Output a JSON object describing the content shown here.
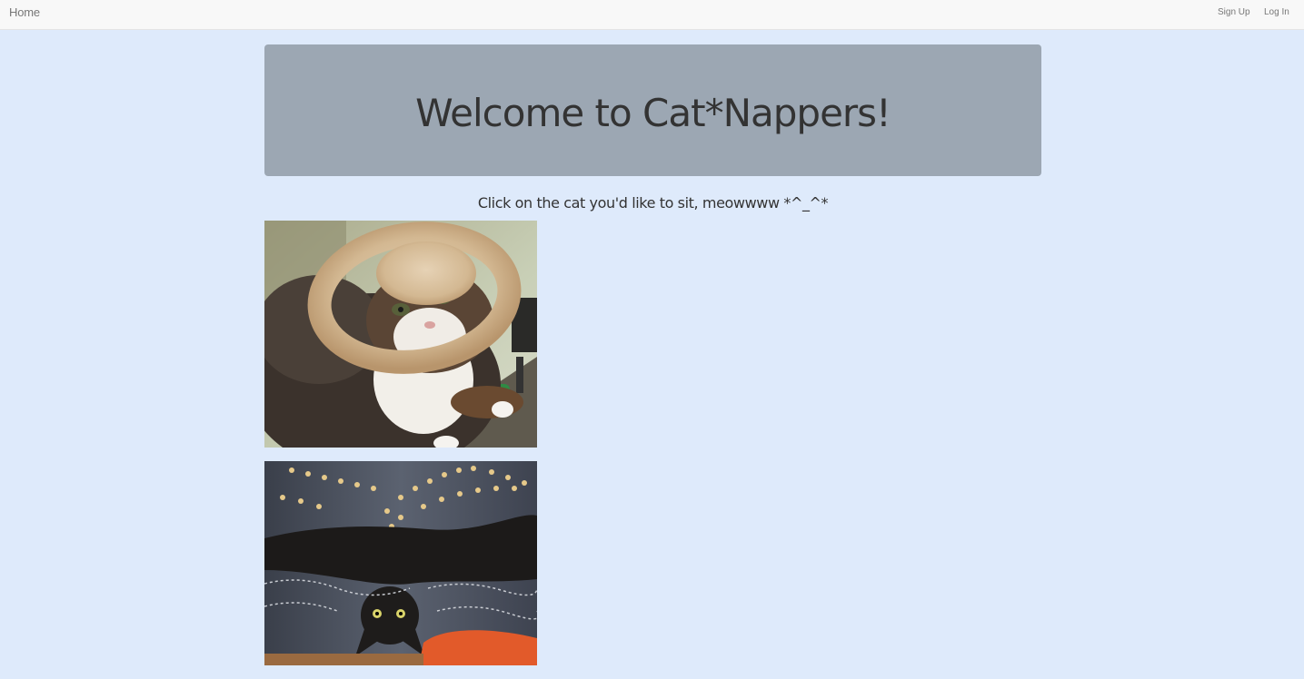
{
  "navbar": {
    "home_label": "Home",
    "signup_label": "Sign Up",
    "login_label": "Log In"
  },
  "jumbotron": {
    "title": "Welcome to Cat*Nappers!"
  },
  "main": {
    "prompt": "Click on the cat you'd like to sit, meowwww *^_^*",
    "cats": [
      {
        "description": "tabby cat wearing a bread hat"
      },
      {
        "description": "black cat lying upside down on a patterned bed"
      }
    ]
  },
  "colors": {
    "page_background": "#deeafb",
    "navbar_background": "#f8f8f8",
    "jumbotron_background": "#9ca7b3",
    "text": "#333333",
    "nav_text": "#777777"
  }
}
